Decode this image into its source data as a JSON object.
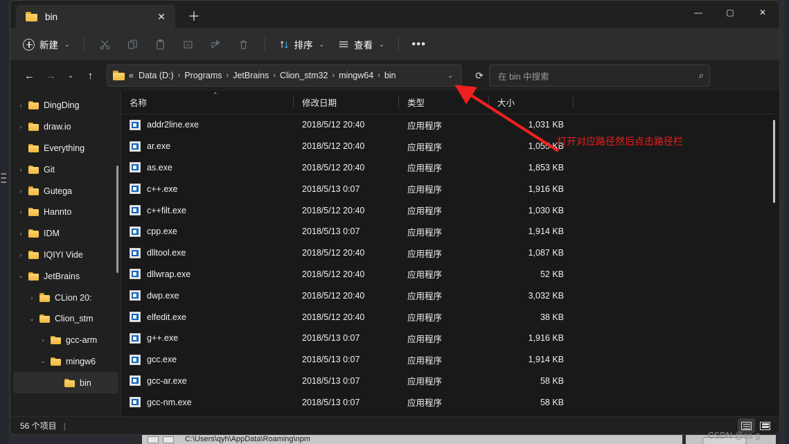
{
  "window": {
    "tab_title": "bin",
    "tab_close_glyph": "✕",
    "new_tab_glyph": "＋",
    "minimize_glyph": "—",
    "maximize_glyph": "▢",
    "close_glyph": "✕"
  },
  "command_bar": {
    "new_label": "新建",
    "chevron": "⌄",
    "cut_label": "剪切",
    "copy_label": "复制",
    "paste_label": "粘贴",
    "rename_label": "重命名",
    "share_label": "共享",
    "delete_label": "删除",
    "sort_label": "排序",
    "view_label": "查看",
    "more_glyph": "•••"
  },
  "address_bar": {
    "back_glyph": "←",
    "forward_glyph": "→",
    "recent_glyph": "⌄",
    "up_glyph": "↑",
    "ellipsis": "«",
    "separator": "›",
    "crumbs": [
      "Data (D:)",
      "Programs",
      "JetBrains",
      "Clion_stm32",
      "mingw64",
      "bin"
    ],
    "dropdown_glyph": "⌄",
    "refresh_glyph": "⟳"
  },
  "search": {
    "placeholder": "在 bin 中搜索",
    "icon_glyph": "⌕"
  },
  "sidebar": {
    "items": [
      {
        "label": "DingDing",
        "expander": "›",
        "indent": 26,
        "selected": false
      },
      {
        "label": "draw.io",
        "expander": "›",
        "indent": 26,
        "selected": false
      },
      {
        "label": "Everything",
        "expander": "",
        "indent": 26,
        "selected": false
      },
      {
        "label": "Git",
        "expander": "›",
        "indent": 26,
        "selected": false
      },
      {
        "label": "Gutega",
        "expander": "›",
        "indent": 26,
        "selected": false
      },
      {
        "label": "Hannto",
        "expander": "›",
        "indent": 26,
        "selected": false
      },
      {
        "label": "IDM",
        "expander": "›",
        "indent": 26,
        "selected": false
      },
      {
        "label": "IQIYI Vide",
        "expander": "›",
        "indent": 26,
        "selected": false
      },
      {
        "label": "JetBrains",
        "expander": "⌄",
        "indent": 26,
        "selected": false
      },
      {
        "label": "CLion 20:",
        "expander": "›",
        "indent": 42,
        "selected": false
      },
      {
        "label": "Clion_stm",
        "expander": "⌄",
        "indent": 42,
        "selected": false
      },
      {
        "label": "gcc-arm",
        "expander": "›",
        "indent": 58,
        "selected": false
      },
      {
        "label": "mingw6",
        "expander": "⌄",
        "indent": 58,
        "selected": false
      },
      {
        "label": "bin",
        "expander": "",
        "indent": 74,
        "selected": true
      }
    ]
  },
  "file_list": {
    "columns": [
      {
        "key": "name",
        "label": "名称"
      },
      {
        "key": "date",
        "label": "修改日期"
      },
      {
        "key": "type",
        "label": "类型"
      },
      {
        "key": "size",
        "label": "大小"
      }
    ],
    "sort_caret": "⌃",
    "rows": [
      {
        "name": "addr2line.exe",
        "date": "2018/5/12 20:40",
        "type": "应用程序",
        "size": "1,031 KB"
      },
      {
        "name": "ar.exe",
        "date": "2018/5/12 20:40",
        "type": "应用程序",
        "size": "1,055 KB"
      },
      {
        "name": "as.exe",
        "date": "2018/5/12 20:40",
        "type": "应用程序",
        "size": "1,853 KB"
      },
      {
        "name": "c++.exe",
        "date": "2018/5/13 0:07",
        "type": "应用程序",
        "size": "1,916 KB"
      },
      {
        "name": "c++filt.exe",
        "date": "2018/5/12 20:40",
        "type": "应用程序",
        "size": "1,030 KB"
      },
      {
        "name": "cpp.exe",
        "date": "2018/5/13 0:07",
        "type": "应用程序",
        "size": "1,914 KB"
      },
      {
        "name": "dlltool.exe",
        "date": "2018/5/12 20:40",
        "type": "应用程序",
        "size": "1,087 KB"
      },
      {
        "name": "dllwrap.exe",
        "date": "2018/5/12 20:40",
        "type": "应用程序",
        "size": "52 KB"
      },
      {
        "name": "dwp.exe",
        "date": "2018/5/12 20:40",
        "type": "应用程序",
        "size": "3,032 KB"
      },
      {
        "name": "elfedit.exe",
        "date": "2018/5/12 20:40",
        "type": "应用程序",
        "size": "38 KB"
      },
      {
        "name": "g++.exe",
        "date": "2018/5/13 0:07",
        "type": "应用程序",
        "size": "1,916 KB"
      },
      {
        "name": "gcc.exe",
        "date": "2018/5/13 0:07",
        "type": "应用程序",
        "size": "1,914 KB"
      },
      {
        "name": "gcc-ar.exe",
        "date": "2018/5/13 0:07",
        "type": "应用程序",
        "size": "58 KB"
      },
      {
        "name": "gcc-nm.exe",
        "date": "2018/5/13 0:07",
        "type": "应用程序",
        "size": "58 KB"
      }
    ]
  },
  "status_bar": {
    "item_count": "56 个项目",
    "separator": "|"
  },
  "watermark": {
    "text": "CSDN @sa       g"
  },
  "annotation": {
    "text": "打开对应路径然后点击路径栏",
    "color": "#f01b1b"
  },
  "background": {
    "other_window_path": "C:\\Users\\qyh\\AppData\\Roaming\\npm"
  }
}
